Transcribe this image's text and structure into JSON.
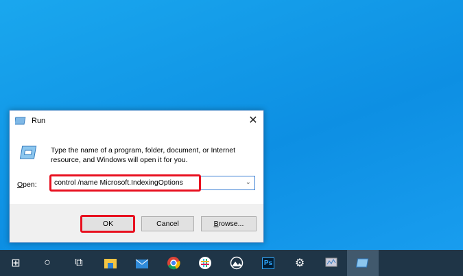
{
  "dialog": {
    "title": "Run",
    "description": "Type the name of a program, folder, document, or Internet resource, and Windows will open it for you.",
    "open_label_underlined": "O",
    "open_label_rest": "pen:",
    "command_value": "control /name Microsoft.IndexingOptions",
    "ok_label": "OK",
    "cancel_label": "Cancel",
    "browse_label_underlined": "B",
    "browse_label_rest": "rowse...",
    "close_glyph": "✕"
  },
  "taskbar": {
    "items": [
      {
        "icon": "start-icon",
        "glyph": "⊞"
      },
      {
        "icon": "search-icon",
        "glyph": "○"
      },
      {
        "icon": "task-view-icon",
        "glyph": "⧉"
      },
      {
        "icon": "file-explorer-icon",
        "glyph": ""
      },
      {
        "icon": "mail-icon",
        "glyph": "✉"
      },
      {
        "icon": "chrome-icon",
        "glyph": ""
      },
      {
        "icon": "slack-icon",
        "glyph": ""
      },
      {
        "icon": "photos-icon",
        "glyph": ""
      },
      {
        "icon": "photoshop-icon",
        "glyph": "Ps"
      },
      {
        "icon": "settings-icon",
        "glyph": "⚙"
      },
      {
        "icon": "performance-monitor-icon",
        "glyph": ""
      },
      {
        "icon": "run-icon",
        "glyph": ""
      }
    ]
  },
  "colors": {
    "highlight": "#e8101f",
    "taskbar": "#1f3547"
  }
}
